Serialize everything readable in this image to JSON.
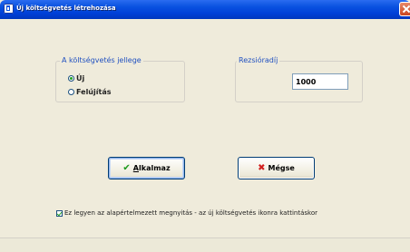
{
  "window": {
    "title": "Új költségvetés létrehozása"
  },
  "budget_type": {
    "legend": "A költségvetés jellege",
    "options": [
      {
        "label": "Új",
        "checked": true
      },
      {
        "label": "Felújítás",
        "checked": false
      }
    ]
  },
  "overhead": {
    "legend": "Rezsióradíj",
    "value": "1000"
  },
  "buttons": {
    "apply_label": "Alkalmaz",
    "cancel_label": "Mégse"
  },
  "default_option": {
    "label": "Ez legyen az alapértelmezett megnyitás - az új költségvetés ikonra kattintáskor",
    "checked": true
  },
  "icons": {
    "apply": "check-icon",
    "cancel": "x-icon",
    "close": "close-icon"
  },
  "colors": {
    "titlebar": "#0a52e0",
    "legend_text": "#2050c0",
    "check_green": "#1c9a1c",
    "cancel_red": "#d22020"
  }
}
